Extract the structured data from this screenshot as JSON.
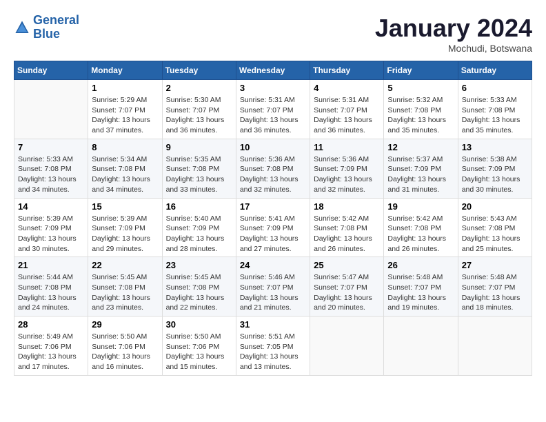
{
  "header": {
    "logo_line1": "General",
    "logo_line2": "Blue",
    "month": "January 2024",
    "location": "Mochudi, Botswana"
  },
  "weekdays": [
    "Sunday",
    "Monday",
    "Tuesday",
    "Wednesday",
    "Thursday",
    "Friday",
    "Saturday"
  ],
  "weeks": [
    [
      {
        "day": "",
        "sunrise": "",
        "sunset": "",
        "daylight": ""
      },
      {
        "day": "1",
        "sunrise": "Sunrise: 5:29 AM",
        "sunset": "Sunset: 7:07 PM",
        "daylight": "Daylight: 13 hours and 37 minutes."
      },
      {
        "day": "2",
        "sunrise": "Sunrise: 5:30 AM",
        "sunset": "Sunset: 7:07 PM",
        "daylight": "Daylight: 13 hours and 36 minutes."
      },
      {
        "day": "3",
        "sunrise": "Sunrise: 5:31 AM",
        "sunset": "Sunset: 7:07 PM",
        "daylight": "Daylight: 13 hours and 36 minutes."
      },
      {
        "day": "4",
        "sunrise": "Sunrise: 5:31 AM",
        "sunset": "Sunset: 7:07 PM",
        "daylight": "Daylight: 13 hours and 36 minutes."
      },
      {
        "day": "5",
        "sunrise": "Sunrise: 5:32 AM",
        "sunset": "Sunset: 7:08 PM",
        "daylight": "Daylight: 13 hours and 35 minutes."
      },
      {
        "day": "6",
        "sunrise": "Sunrise: 5:33 AM",
        "sunset": "Sunset: 7:08 PM",
        "daylight": "Daylight: 13 hours and 35 minutes."
      }
    ],
    [
      {
        "day": "7",
        "sunrise": "Sunrise: 5:33 AM",
        "sunset": "Sunset: 7:08 PM",
        "daylight": "Daylight: 13 hours and 34 minutes."
      },
      {
        "day": "8",
        "sunrise": "Sunrise: 5:34 AM",
        "sunset": "Sunset: 7:08 PM",
        "daylight": "Daylight: 13 hours and 34 minutes."
      },
      {
        "day": "9",
        "sunrise": "Sunrise: 5:35 AM",
        "sunset": "Sunset: 7:08 PM",
        "daylight": "Daylight: 13 hours and 33 minutes."
      },
      {
        "day": "10",
        "sunrise": "Sunrise: 5:36 AM",
        "sunset": "Sunset: 7:08 PM",
        "daylight": "Daylight: 13 hours and 32 minutes."
      },
      {
        "day": "11",
        "sunrise": "Sunrise: 5:36 AM",
        "sunset": "Sunset: 7:09 PM",
        "daylight": "Daylight: 13 hours and 32 minutes."
      },
      {
        "day": "12",
        "sunrise": "Sunrise: 5:37 AM",
        "sunset": "Sunset: 7:09 PM",
        "daylight": "Daylight: 13 hours and 31 minutes."
      },
      {
        "day": "13",
        "sunrise": "Sunrise: 5:38 AM",
        "sunset": "Sunset: 7:09 PM",
        "daylight": "Daylight: 13 hours and 30 minutes."
      }
    ],
    [
      {
        "day": "14",
        "sunrise": "Sunrise: 5:39 AM",
        "sunset": "Sunset: 7:09 PM",
        "daylight": "Daylight: 13 hours and 30 minutes."
      },
      {
        "day": "15",
        "sunrise": "Sunrise: 5:39 AM",
        "sunset": "Sunset: 7:09 PM",
        "daylight": "Daylight: 13 hours and 29 minutes."
      },
      {
        "day": "16",
        "sunrise": "Sunrise: 5:40 AM",
        "sunset": "Sunset: 7:09 PM",
        "daylight": "Daylight: 13 hours and 28 minutes."
      },
      {
        "day": "17",
        "sunrise": "Sunrise: 5:41 AM",
        "sunset": "Sunset: 7:09 PM",
        "daylight": "Daylight: 13 hours and 27 minutes."
      },
      {
        "day": "18",
        "sunrise": "Sunrise: 5:42 AM",
        "sunset": "Sunset: 7:08 PM",
        "daylight": "Daylight: 13 hours and 26 minutes."
      },
      {
        "day": "19",
        "sunrise": "Sunrise: 5:42 AM",
        "sunset": "Sunset: 7:08 PM",
        "daylight": "Daylight: 13 hours and 26 minutes."
      },
      {
        "day": "20",
        "sunrise": "Sunrise: 5:43 AM",
        "sunset": "Sunset: 7:08 PM",
        "daylight": "Daylight: 13 hours and 25 minutes."
      }
    ],
    [
      {
        "day": "21",
        "sunrise": "Sunrise: 5:44 AM",
        "sunset": "Sunset: 7:08 PM",
        "daylight": "Daylight: 13 hours and 24 minutes."
      },
      {
        "day": "22",
        "sunrise": "Sunrise: 5:45 AM",
        "sunset": "Sunset: 7:08 PM",
        "daylight": "Daylight: 13 hours and 23 minutes."
      },
      {
        "day": "23",
        "sunrise": "Sunrise: 5:45 AM",
        "sunset": "Sunset: 7:08 PM",
        "daylight": "Daylight: 13 hours and 22 minutes."
      },
      {
        "day": "24",
        "sunrise": "Sunrise: 5:46 AM",
        "sunset": "Sunset: 7:07 PM",
        "daylight": "Daylight: 13 hours and 21 minutes."
      },
      {
        "day": "25",
        "sunrise": "Sunrise: 5:47 AM",
        "sunset": "Sunset: 7:07 PM",
        "daylight": "Daylight: 13 hours and 20 minutes."
      },
      {
        "day": "26",
        "sunrise": "Sunrise: 5:48 AM",
        "sunset": "Sunset: 7:07 PM",
        "daylight": "Daylight: 13 hours and 19 minutes."
      },
      {
        "day": "27",
        "sunrise": "Sunrise: 5:48 AM",
        "sunset": "Sunset: 7:07 PM",
        "daylight": "Daylight: 13 hours and 18 minutes."
      }
    ],
    [
      {
        "day": "28",
        "sunrise": "Sunrise: 5:49 AM",
        "sunset": "Sunset: 7:06 PM",
        "daylight": "Daylight: 13 hours and 17 minutes."
      },
      {
        "day": "29",
        "sunrise": "Sunrise: 5:50 AM",
        "sunset": "Sunset: 7:06 PM",
        "daylight": "Daylight: 13 hours and 16 minutes."
      },
      {
        "day": "30",
        "sunrise": "Sunrise: 5:50 AM",
        "sunset": "Sunset: 7:06 PM",
        "daylight": "Daylight: 13 hours and 15 minutes."
      },
      {
        "day": "31",
        "sunrise": "Sunrise: 5:51 AM",
        "sunset": "Sunset: 7:05 PM",
        "daylight": "Daylight: 13 hours and 13 minutes."
      },
      {
        "day": "",
        "sunrise": "",
        "sunset": "",
        "daylight": ""
      },
      {
        "day": "",
        "sunrise": "",
        "sunset": "",
        "daylight": ""
      },
      {
        "day": "",
        "sunrise": "",
        "sunset": "",
        "daylight": ""
      }
    ]
  ]
}
